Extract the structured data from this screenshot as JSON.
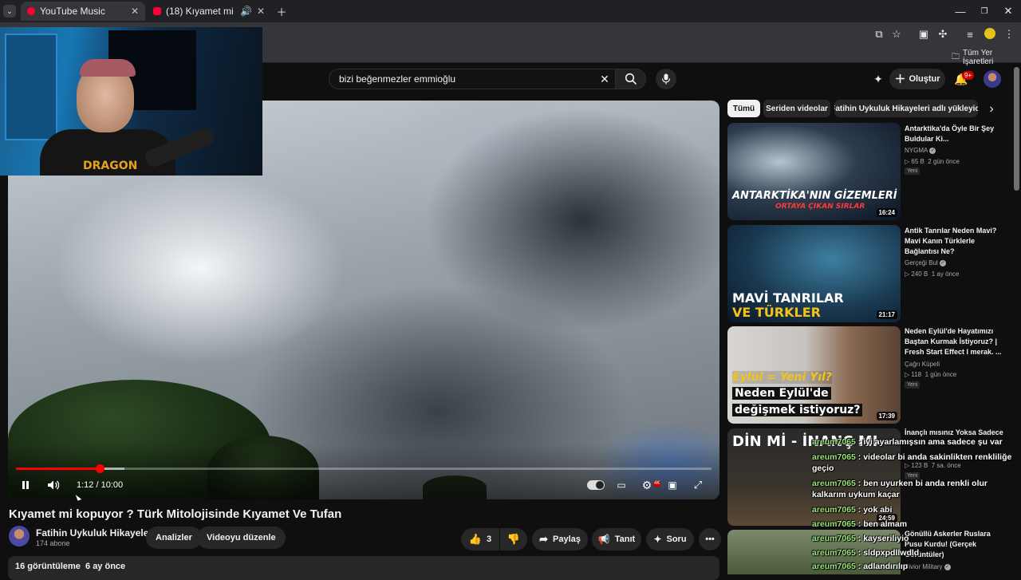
{
  "browser": {
    "tabs": [
      {
        "label": "YouTube Music",
        "active": true
      },
      {
        "label": "(18) Kıyamet mi kopuyor ? ",
        "active": false
      }
    ],
    "bookmarks_label": "Tüm Yer İşaretleri"
  },
  "header": {
    "search_value": "bizi beğenmezler emmioğlu",
    "create_label": "Oluştur",
    "notification_count": "9+"
  },
  "player": {
    "current_time": "1:12",
    "separator": " / ",
    "duration": "10:00",
    "progress": 0.12,
    "hd_badge": "4K"
  },
  "video": {
    "title": "Kıyamet mi kopuyor ? Türk Mitolojisinde Kıyamet Ve Tufan",
    "channel_name": "Fatihin Uykuluk Hikayeleri",
    "subscribers": "174 abone",
    "analytics_label": "Analizler",
    "edit_label": "Videoyu düzenle",
    "like_count": "3",
    "share_label": "Paylaş",
    "promote_label": "Tanıt",
    "ask_label": "Soru",
    "description_meta": "16 görüntüleme  6 ay önce"
  },
  "chips": [
    "Tümü",
    "Seriden videolar",
    "Fatihin Uykuluk Hikayeleri adlı yükleyici"
  ],
  "related": [
    {
      "title": "Antarktika'da Öyle Bir Şey Buldular Ki...",
      "channel": "NYGMA",
      "verified": true,
      "views": "65 B",
      "age": "2 gün önce",
      "new": "Yeni",
      "duration": "16:24",
      "thumb_line1": "ANTARKTİKA'NIN GİZEMLERİ",
      "thumb_line2": "ORTAYA ÇIKAN SIRLAR"
    },
    {
      "title": "Antik Tanrılar Neden Mavi? Mavi Kanın Türklerle Bağlantısı Ne?",
      "channel": "Gerçeği Bul",
      "verified": true,
      "views": "240 B",
      "age": "1 ay önce",
      "duration": "21:17",
      "thumb_line1": "MAVİ TANRILAR",
      "thumb_line2": "VE TÜRKLER"
    },
    {
      "title": "Neden Eylül'de Hayatımızı Baştan Kurmak İstiyoruz? | Fresh Start Effect l merak. ...",
      "channel": "Çağrı Küpeli",
      "verified": false,
      "views": "118",
      "age": "1 gün önce",
      "new": "Yeni",
      "duration": "17:39",
      "thumb_line1": "Eylül = Yeni Yıl?",
      "thumb_line2": "Neden Eylül'de",
      "thumb_line3": "değişmek istiyoruz?"
    },
    {
      "title": "İnançlı mısınız Yoksa Sadece",
      "views": "123 B",
      "age": "7 sa. önce",
      "new": "Yeni",
      "duration": "24:59",
      "thumb_line1": "DİN Mİ - İNANÇ MI"
    },
    {
      "title": "Gönüllü Askerler Ruslara Pusu Kurdu! (Gerçek Görüntüler)",
      "channel": "Sivior Military",
      "verified": true
    }
  ],
  "chat": [
    {
      "user": "areum7065",
      "message": "iyi ayarlamışsın ama sadece şu var"
    },
    {
      "user": "areum7065",
      "message": "videolar bi anda sakinlikten renkliliğe geçio"
    },
    {
      "user": "areum7065",
      "message": "ben uyurken bi anda renkli olur kalkarım uykum kaçar"
    },
    {
      "user": "areum7065",
      "message": "yok abi"
    },
    {
      "user": "areum7065",
      "message": "ben almam"
    },
    {
      "user": "areum7065",
      "message": "kayseriliyio"
    },
    {
      "user": "areum7065",
      "message": "sldpxpdllwdld"
    },
    {
      "user": "areum7065",
      "message": "adlandırılıp"
    }
  ],
  "colors": {
    "accent": "#ff0000",
    "background": "#0f0f0f",
    "chat_user": "#9be37a"
  }
}
